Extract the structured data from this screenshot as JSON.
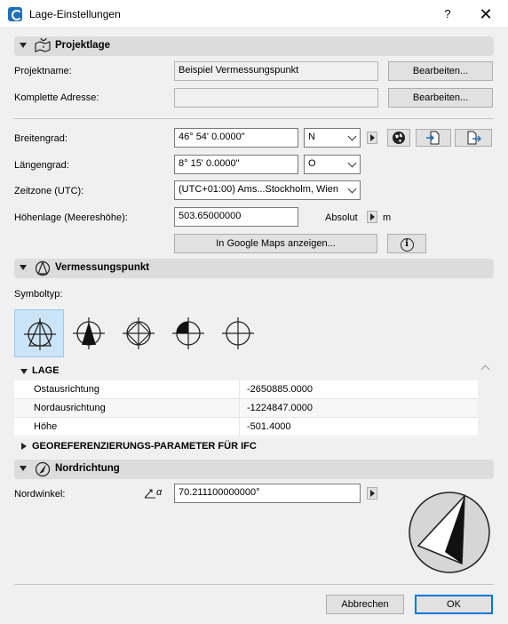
{
  "window": {
    "title": "Lage-Einstellungen",
    "help": "?",
    "close": "✕"
  },
  "projektlage": {
    "header": "Projektlage",
    "projektname_label": "Projektname:",
    "projektname_value": "Beispiel Vermessungspunkt",
    "adresse_label": "Komplette Adresse:",
    "adresse_value": "",
    "bearbeiten_label": "Bearbeiten...",
    "breitengrad_label": "Breitengrad:",
    "breitengrad_value": "46° 54' 0.0000\"",
    "breitengrad_dir": "N",
    "laengengrad_label": "Längengrad:",
    "laengengrad_value": "8° 15' 0.0000\"",
    "laengengrad_dir": "O",
    "zeitzone_label": "Zeitzone (UTC):",
    "zeitzone_value": "(UTC+01:00) Ams...Stockholm, Wien",
    "hoehe_label": "Höhenlage (Meereshöhe):",
    "hoehe_value": "503.65000000",
    "hoehe_ref": "Absolut",
    "hoehe_unit": "m",
    "maps_label": "In Google Maps anzeigen...",
    "info_glyph": "i"
  },
  "vermessungspunkt": {
    "header": "Vermessungspunkt",
    "symboltyp_label": "Symboltyp:",
    "selected_symbol": 1,
    "lage_header": "LAGE",
    "rows": [
      {
        "key": "Ostausrichtung",
        "value": "-2650885.0000"
      },
      {
        "key": "Nordausrichtung",
        "value": "-1224847.0000"
      },
      {
        "key": "Höhe",
        "value": "-501.4000"
      }
    ],
    "ifc_header": "GEOREFERENZIERUNGS-PARAMETER FÜR IFC"
  },
  "nordrichtung": {
    "header": "Nordrichtung",
    "nordwinkel_label": "Nordwinkel:",
    "nordwinkel_value": "70.211100000000°",
    "angle_symbol": "α"
  },
  "footer": {
    "cancel": "Abbrechen",
    "ok": "OK"
  },
  "colors": {
    "accent": "#0078d7",
    "section_bg": "#dcdcdc",
    "selected_bg": "#cce4f7"
  }
}
